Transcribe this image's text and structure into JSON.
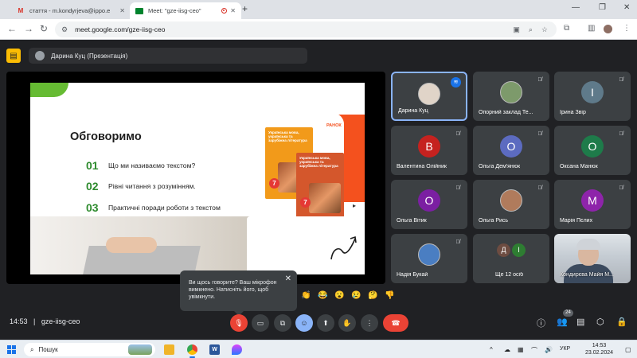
{
  "browser": {
    "tabs": [
      {
        "title": "стаття - m.kondyrjeva@ippo.e",
        "favicon": "gmail-icon"
      },
      {
        "title": "Meet: \"gze-iisg-ceo\"",
        "favicon": "meet-icon"
      }
    ],
    "url": "meet.google.com/gze-iisg-ceo"
  },
  "meet": {
    "presenter_label": "Дарина Куц (Презентація)",
    "slide": {
      "title": "Обговоримо",
      "items": [
        {
          "num": "01",
          "text": "Що ми називаємо текстом?"
        },
        {
          "num": "02",
          "text": "Рівні читання з розумінням."
        },
        {
          "num": "03",
          "text": "Практичні поради роботи з текстом"
        }
      ],
      "publisher": "РАНОК",
      "book_text": "Українська мова, українська та зарубіжна література",
      "grade": "7"
    },
    "participants": [
      {
        "name": "Дарина Куц",
        "initial": "",
        "color": "#c8b8a8",
        "speaking": true
      },
      {
        "name": "Опорний заклад Те...",
        "initial": "",
        "color": "#7d9a6b",
        "speaking": false
      },
      {
        "name": "Ірина Звір",
        "initial": "І",
        "color": "#5f7a8a",
        "speaking": false
      },
      {
        "name": "Валентина Олійник",
        "initial": "В",
        "color": "#c5221f",
        "speaking": false
      },
      {
        "name": "Ольга Дем'янюк",
        "initial": "О",
        "color": "#5c6bc0",
        "speaking": false
      },
      {
        "name": "Оксана Манюк",
        "initial": "О",
        "color": "#1e7b4a",
        "speaking": false
      },
      {
        "name": "Ольга Вітик",
        "initial": "О",
        "color": "#7b1fa2",
        "speaking": false
      },
      {
        "name": "Ольга Рись",
        "initial": "",
        "color": "#b07b5c",
        "speaking": false
      },
      {
        "name": "Марія Пєлих",
        "initial": "М",
        "color": "#8e24aa",
        "speaking": false
      },
      {
        "name": "Надія Букай",
        "initial": "",
        "color": "#4a7ec2",
        "speaking": false
      },
      {
        "name": "Ще 12 осіб",
        "initial": "",
        "color": "#3c4043",
        "speaking": false
      },
      {
        "name": "Кондирєва Майя М...",
        "initial": "",
        "color": "#c5ccd3",
        "speaking": false
      }
    ],
    "more_avatars": [
      {
        "initial": "Д",
        "color": "#6d4c41"
      },
      {
        "initial": "І",
        "color": "#2e7d32"
      }
    ],
    "toast": {
      "text": "Ви щось говорите? Ваш мікрофон вимкнено. Натисніть його, щоб увімкнути."
    },
    "emojis": [
      "👏",
      "😂",
      "😮",
      "😢",
      "🤔",
      "👎"
    ],
    "time": "14:53",
    "separator": "|",
    "meeting_code": "gze-iisg-ceo",
    "people_count": "24"
  },
  "taskbar": {
    "search_placeholder": "Пошук",
    "lang": "УКР",
    "time": "14:53",
    "date": "23.02.2024"
  }
}
